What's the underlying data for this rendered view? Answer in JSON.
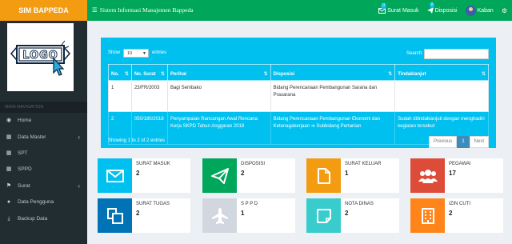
{
  "header": {
    "brand": "SIM BAPPEDA",
    "title": "Sistem Informasi Manajemen Bappeda",
    "surat_masuk": "Surat Masuk",
    "surat_masuk_badge": "0",
    "disposisi": "Disposisi",
    "disposisi_badge": "0",
    "user": "Kaban"
  },
  "sidebar": {
    "logo_text": "LOGO",
    "nav_header": "MAIN NAVIGATION",
    "items": [
      {
        "label": "Home",
        "icon": "dashboard-icon"
      },
      {
        "label": "Data Master",
        "icon": "table-icon",
        "has_submenu": true
      },
      {
        "label": "SPT",
        "icon": "table-icon"
      },
      {
        "label": "SPPD",
        "icon": "table-icon"
      },
      {
        "label": "Surat",
        "icon": "bookmark-icon",
        "has_submenu": true
      },
      {
        "label": "Data Pengguna",
        "icon": "user-icon"
      },
      {
        "label": "Backup Data",
        "icon": "download-icon"
      }
    ]
  },
  "table": {
    "show_label": "Show",
    "entries_value": "10",
    "entries_label": "entries",
    "search_label": "Search:",
    "columns": [
      "No.",
      "No. Surat",
      "Perihal",
      "Disposisi",
      "Tindaklanjut"
    ],
    "rows": [
      {
        "no": "1",
        "no_surat": "23/FR/2003",
        "perihal": "Bagi Sembako",
        "disposisi": "Bidang Perencanaan Pembangunan Sarana dan Prasarana",
        "tindaklanjut": ""
      },
      {
        "no": "2",
        "no_surat": "050/180/2018",
        "perihal": "Penyampaian Rancangan Awal Rencana Kerja SKPD Tahun Anggaran 2018",
        "disposisi": "Bidang Perencanaan Pembangunan Ekonomi dan Ketenagakerjaan ➔ Subbidang Pertanian",
        "tindaklanjut": "Sudah ditindaklanjuti dengan menghadiri kegiatan tersebut"
      }
    ],
    "info": "Showing 1 to 2 of 2 entries",
    "pager": {
      "previous": "Previous",
      "page": "1",
      "next": "Next"
    }
  },
  "cards": [
    {
      "title": "SURAT MASUK",
      "value": "2",
      "color": "#00c0ef",
      "icon": "envelope-icon"
    },
    {
      "title": "DISPOSISI",
      "value": "2",
      "color": "#00a65a",
      "icon": "paper-plane-icon"
    },
    {
      "title": "SURAT KELUAR",
      "value": "1",
      "color": "#f39c12",
      "icon": "file-icon"
    },
    {
      "title": "PEGAWAI",
      "value": "17",
      "color": "#dd4b39",
      "icon": "users-icon"
    },
    {
      "title": "SURAT TUGAS",
      "value": "2",
      "color": "#0073b7",
      "icon": "copy-icon"
    },
    {
      "title": "S P P D",
      "value": "1",
      "color": "#d2d6de",
      "icon": "plane-icon"
    },
    {
      "title": "NOTA DINAS",
      "value": "2",
      "color": "#39cccc",
      "icon": "sticky-note-icon"
    },
    {
      "title": "IZIN CUTI",
      "value": "2",
      "color": "#ff851b",
      "icon": "building-icon"
    }
  ]
}
